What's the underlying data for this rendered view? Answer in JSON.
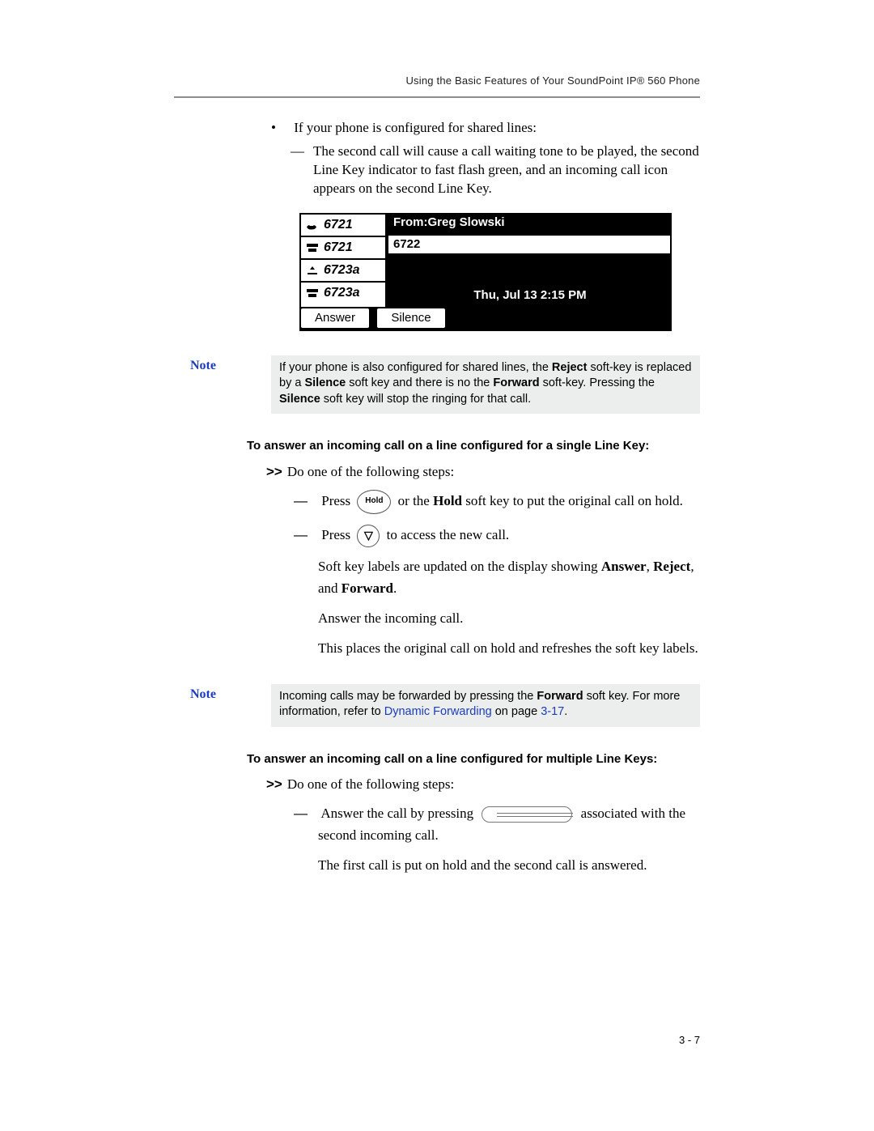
{
  "header": {
    "running": "Using the Basic Features of Your SoundPoint IP® 560 Phone"
  },
  "intro": {
    "bullet": "If your phone is configured for shared lines:",
    "sub": "The second call will cause a call waiting tone to be played, the second Line Key indicator to fast flash green, and an incoming call icon appears on the second Line Key."
  },
  "phone": {
    "lines": [
      "6721",
      "6721",
      "6723a",
      "6723a"
    ],
    "from_label": "From:",
    "from_name": "Greg Slowski",
    "from_num": "6722",
    "datetime": "Thu, Jul 13  2:15 PM",
    "sk1": "Answer",
    "sk2": "Silence"
  },
  "note1": {
    "label": "Note",
    "t1": "If your phone is also configured for shared lines, the ",
    "b1": "Reject",
    "t2": " soft-key is replaced by a ",
    "b2": "Silence",
    "t3": " soft key and there is no the ",
    "b3": "Forward",
    "t4": " soft-key. Pressing the ",
    "b4": "Silence",
    "t5": " soft key will stop the ringing for that call."
  },
  "sec1": {
    "head": "To answer an incoming call on a line configured for a single Line Key:",
    "intro_pre": ">>",
    "intro": "Do one of the following steps:",
    "s1_a": "Press ",
    "s1_key": "Hold",
    "s1_b": " or the ",
    "s1_bold": "Hold",
    "s1_c": " soft key to put the original call on hold.",
    "s2_a": "Press ",
    "s2_b": " to access the new call.",
    "s2_p1a": "Soft key labels are updated on the display showing ",
    "s2_b1": "Answer",
    "s2_comma1": ", ",
    "s2_b2": "Reject",
    "s2_comma2": ", and ",
    "s2_b3": "Forward",
    "s2_period": ".",
    "s2_p2": "Answer the incoming call.",
    "s2_p3": "This places the original call on hold and refreshes the soft key labels."
  },
  "note2": {
    "label": "Note",
    "t1": "Incoming calls may be forwarded by pressing the ",
    "b1": "Forward",
    "t2": " soft key. For more information, refer to ",
    "link": "Dynamic Forwarding",
    "t3": " on page ",
    "page": "3-17",
    "t4": "."
  },
  "sec2": {
    "head": "To answer an incoming call on a line configured for multiple Line Keys:",
    "intro_pre": ">>",
    "intro": "Do one of the following steps:",
    "s1_a": "Answer the call by pressing ",
    "s1_b": " associated with the second incoming call.",
    "s1_p1": "The first call is put on hold and the second call is answered."
  },
  "footer": {
    "page": "3 - 7"
  }
}
